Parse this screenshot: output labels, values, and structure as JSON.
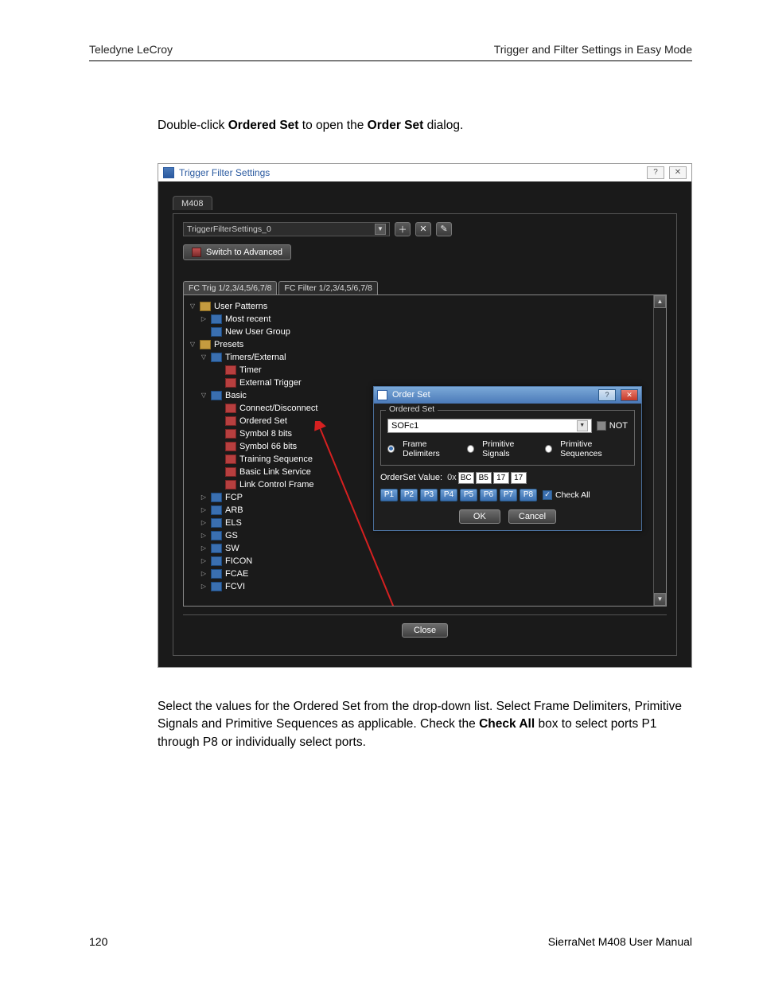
{
  "header": {
    "left": "Teledyne LeCroy",
    "right": "Trigger and Filter Settings in Easy Mode"
  },
  "intro": {
    "pre": "Double-click ",
    "b1": "Ordered Set",
    "mid": " to open the ",
    "b2": "Order Set",
    "post": " dialog."
  },
  "window": {
    "title": "Trigger Filter Settings",
    "help": "?",
    "close": "✕",
    "tab": "M408",
    "settings_name": "TriggerFilterSettings_0",
    "switch_label": "Switch to Advanced",
    "subtabs": {
      "a": "FC Trig 1/2,3/4,5/6,7/8",
      "b": "FC Filter 1/2,3/4,5/6,7/8"
    },
    "tree": {
      "user_patterns": "User Patterns",
      "most_recent": "Most recent",
      "new_user_group": "New User Group",
      "presets": "Presets",
      "timers_external": "Timers/External",
      "timer": "Timer",
      "external_trigger": "External Trigger",
      "basic": "Basic",
      "connect_disconnect": "Connect/Disconnect",
      "ordered_set": "Ordered Set",
      "symbol8": "Symbol 8 bits",
      "symbol66": "Symbol 66 bits",
      "training": "Training Sequence",
      "bls": "Basic Link Service",
      "lcf": "Link Control Frame",
      "fcp": "FCP",
      "arb": "ARB",
      "els": "ELS",
      "gs": "GS",
      "sw": "SW",
      "ficon": "FICON",
      "fcae": "FCAE",
      "fcvi": "FCVI"
    },
    "close_label": "Close"
  },
  "dialog": {
    "title": "Order Set",
    "legend": "Ordered Set",
    "combo_value": "SOFc1",
    "not_label": "NOT",
    "radios": {
      "a": "Frame Delimiters",
      "b": "Primitive Signals",
      "c": "Primitive Sequences"
    },
    "value_label": "OrderSet Value:",
    "hex_prefix": "0x",
    "hex": [
      "BC",
      "B5",
      "17",
      "17"
    ],
    "ports": [
      "P1",
      "P2",
      "P3",
      "P4",
      "P5",
      "P6",
      "P7",
      "P8"
    ],
    "checkall": "Check All",
    "ok": "OK",
    "cancel": "Cancel",
    "help": "?",
    "close": "✕"
  },
  "outro": {
    "p1a": "Select the values for the Ordered Set from the drop-down list. Select Frame Delimiters, Primitive Signals and Primitive Sequences as applicable. Check the ",
    "p1b": "Check All",
    "p1c": " box to select ports P1 through P8 or individually select ports."
  },
  "footer": {
    "page": "120",
    "manual": "SierraNet M408 User Manual"
  }
}
